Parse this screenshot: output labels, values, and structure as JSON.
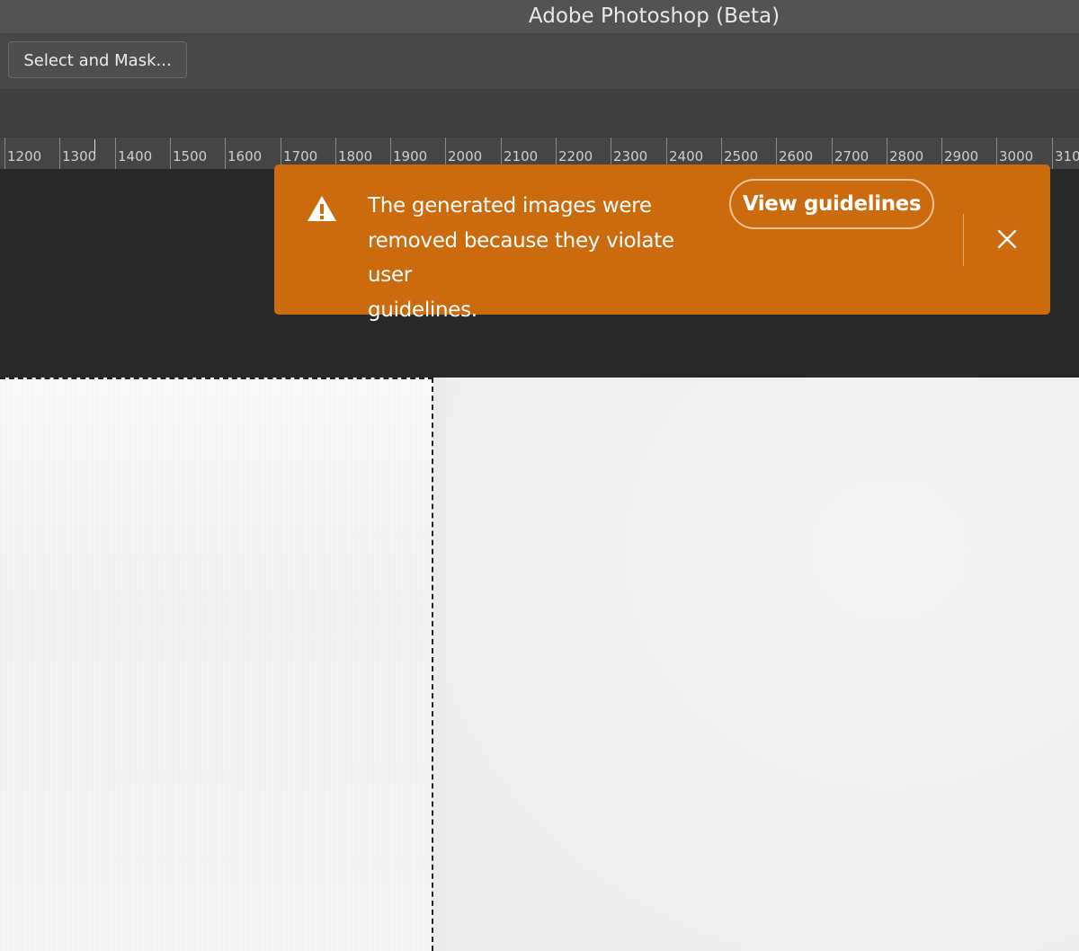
{
  "app": {
    "title": "Adobe Photoshop (Beta)"
  },
  "options_bar": {
    "select_and_mask_label": "Select and Mask..."
  },
  "ruler": {
    "labels": [
      "1200",
      "1300",
      "1400",
      "1500",
      "1600",
      "1700",
      "1800",
      "1900",
      "2000",
      "2100",
      "2200",
      "2300",
      "2400",
      "2500",
      "2600",
      "2700",
      "2800",
      "2900",
      "3000",
      "310"
    ]
  },
  "toast": {
    "icon": "warning-icon",
    "message": "The generated images were removed because they violate user guidelines.",
    "message_lines": [
      "The generated images were",
      "removed because they violate user",
      "guidelines."
    ],
    "action_label": "View guidelines",
    "close_icon": "close-icon",
    "background_color": "#cb6b0e"
  }
}
